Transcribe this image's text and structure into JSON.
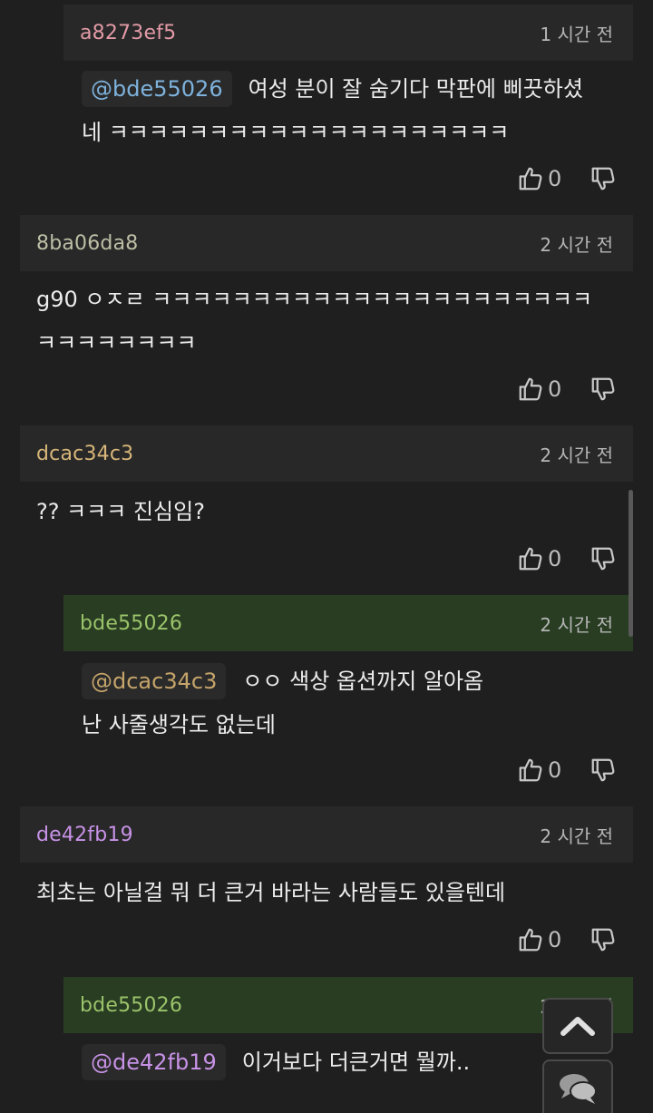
{
  "colors": {
    "page_bg": "#1f1f1f",
    "header_bg": "#282828",
    "reply_header_bg": "#283d22",
    "mention_bg": "#2a2a2a",
    "user_pink": "#e29aa6",
    "user_gray": "#bdbfa6",
    "user_gold": "#d7b679",
    "user_green": "#9bc36a",
    "user_purple": "#c792e6",
    "mention_blue": "#7eb2dc",
    "mention_gold": "#c5a46a"
  },
  "comments": [
    {
      "user": "a8273ef5",
      "time": "1 시간 전",
      "mention": "@bde55026",
      "line1": "여성 분이 잘 숨기다 막판에 삐끗하셨",
      "line2": "네 ㅋㅋㅋㅋㅋㅋㅋㅋㅋㅋㅋㅋㅋㅋㅋㅋㅋㅋㅋㅋ",
      "likes": "0"
    },
    {
      "user": "8ba06da8",
      "time": "2 시간 전",
      "line1": "g90 ㅇㅈㄹ ㅋㅋㅋㅋㅋㅋㅋㅋㅋㅋㅋㅋㅋㅋㅋㅋㅋㅋㅋㅋㅋㅋ",
      "line2": "ㅋㅋㅋㅋㅋㅋㅋㅋ",
      "likes": "0"
    },
    {
      "user": "dcac34c3",
      "time": "2 시간 전",
      "line1": "?? ㅋㅋㅋ 진심임?",
      "likes": "0"
    },
    {
      "user": "bde55026",
      "time": "2 시간 전",
      "mention": "@dcac34c3",
      "line1": "ㅇㅇ 색상 옵션까지 알아옴",
      "line2": "난 사줄생각도 없는데",
      "likes": "0"
    },
    {
      "user": "de42fb19",
      "time": "2 시간 전",
      "line1": "최초는 아닐걸 뭐 더 큰거 바라는 사람들도 있을텐데",
      "likes": "0"
    },
    {
      "user": "bde55026",
      "time": "2 시간 전",
      "mention": "@de42fb19",
      "line1": "이거보다 더큰거면 뭘까.."
    }
  ],
  "icons": {
    "like": "thumbs-up-icon",
    "dislike": "thumbs-down-icon",
    "scroll_top": "chevron-up-icon",
    "chat": "chat-bubbles-icon"
  }
}
